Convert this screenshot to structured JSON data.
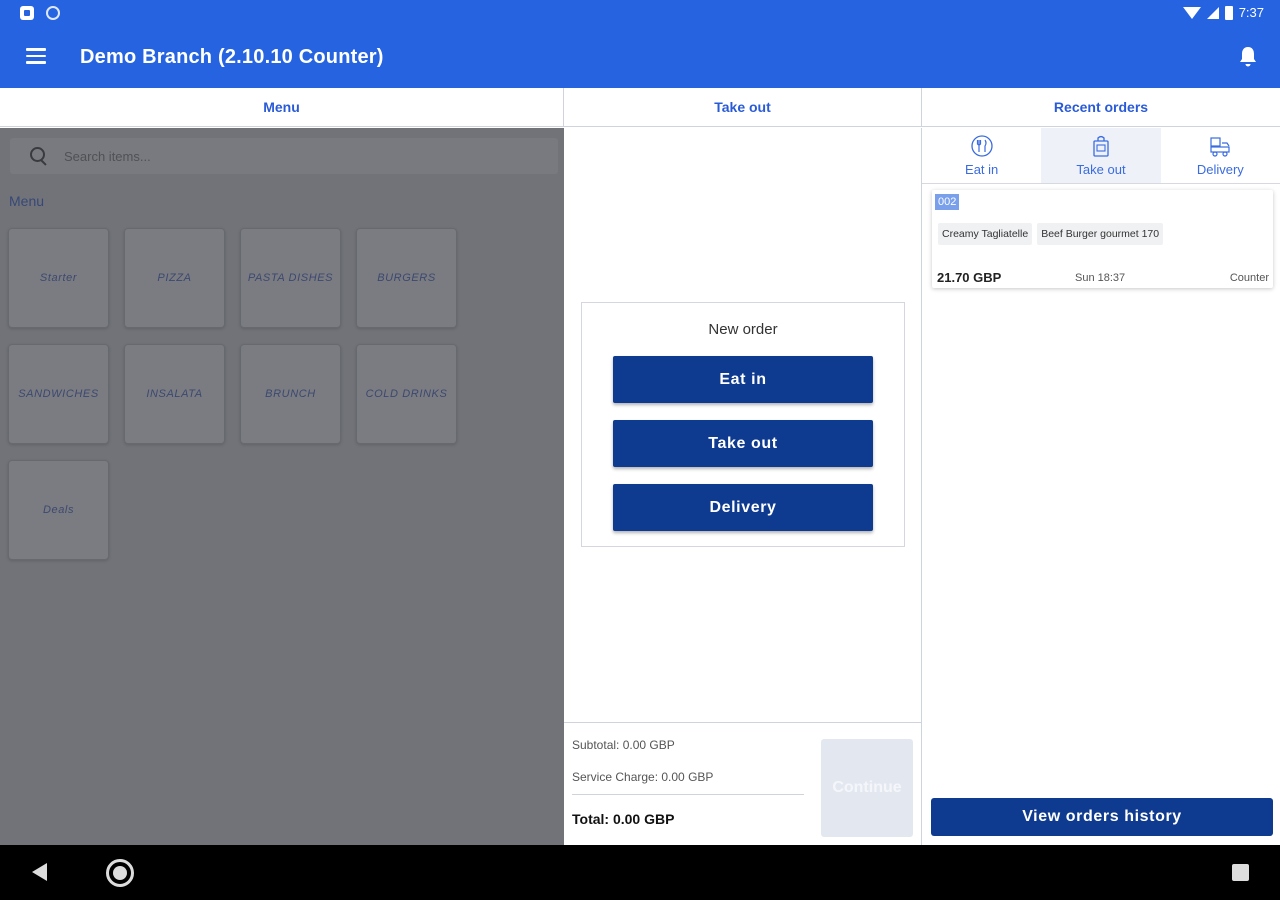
{
  "status_bar": {
    "time": "7:37"
  },
  "app_bar": {
    "title": "Demo Branch (2.10.10 Counter)",
    "menu_icon": "hamburger-icon",
    "notification_icon": "bell-icon"
  },
  "column_headers": {
    "menu": "Menu",
    "take_out": "Take out",
    "recent_orders": "Recent orders"
  },
  "menu_panel": {
    "search_placeholder": "Search items...",
    "section_label": "Menu",
    "categories": [
      "Starter",
      "PIZZA",
      "PASTA DISHES",
      "BURGERS",
      "SANDWICHES",
      "INSALATA",
      "BRUNCH",
      "COLD DRINKS",
      "Deals"
    ]
  },
  "new_order": {
    "title": "New order",
    "buttons": [
      "Eat in",
      "Take out",
      "Delivery"
    ]
  },
  "totals": {
    "subtotal": "Subtotal: 0.00 GBP",
    "service_charge": "Service Charge: 0.00 GBP",
    "total": "Total: 0.00 GBP",
    "continue_label": "Continue"
  },
  "recent_orders": {
    "tabs": [
      {
        "label": "Eat in",
        "icon": "dining-icon"
      },
      {
        "label": "Take out",
        "icon": "takeout-bag-icon"
      },
      {
        "label": "Delivery",
        "icon": "delivery-icon"
      }
    ],
    "active_tab": "Take out",
    "orders": [
      {
        "number": "002",
        "items": [
          "Creamy Tagliatelle",
          "Beef Burger gourmet 170"
        ],
        "price": "21.70 GBP",
        "time": "Sun 18:37",
        "source": "Counter"
      }
    ],
    "history_button": "View orders history"
  },
  "colors": {
    "primary": "#2563e0",
    "button": "#0e3a8f",
    "accent_text": "#2a5bd7"
  }
}
